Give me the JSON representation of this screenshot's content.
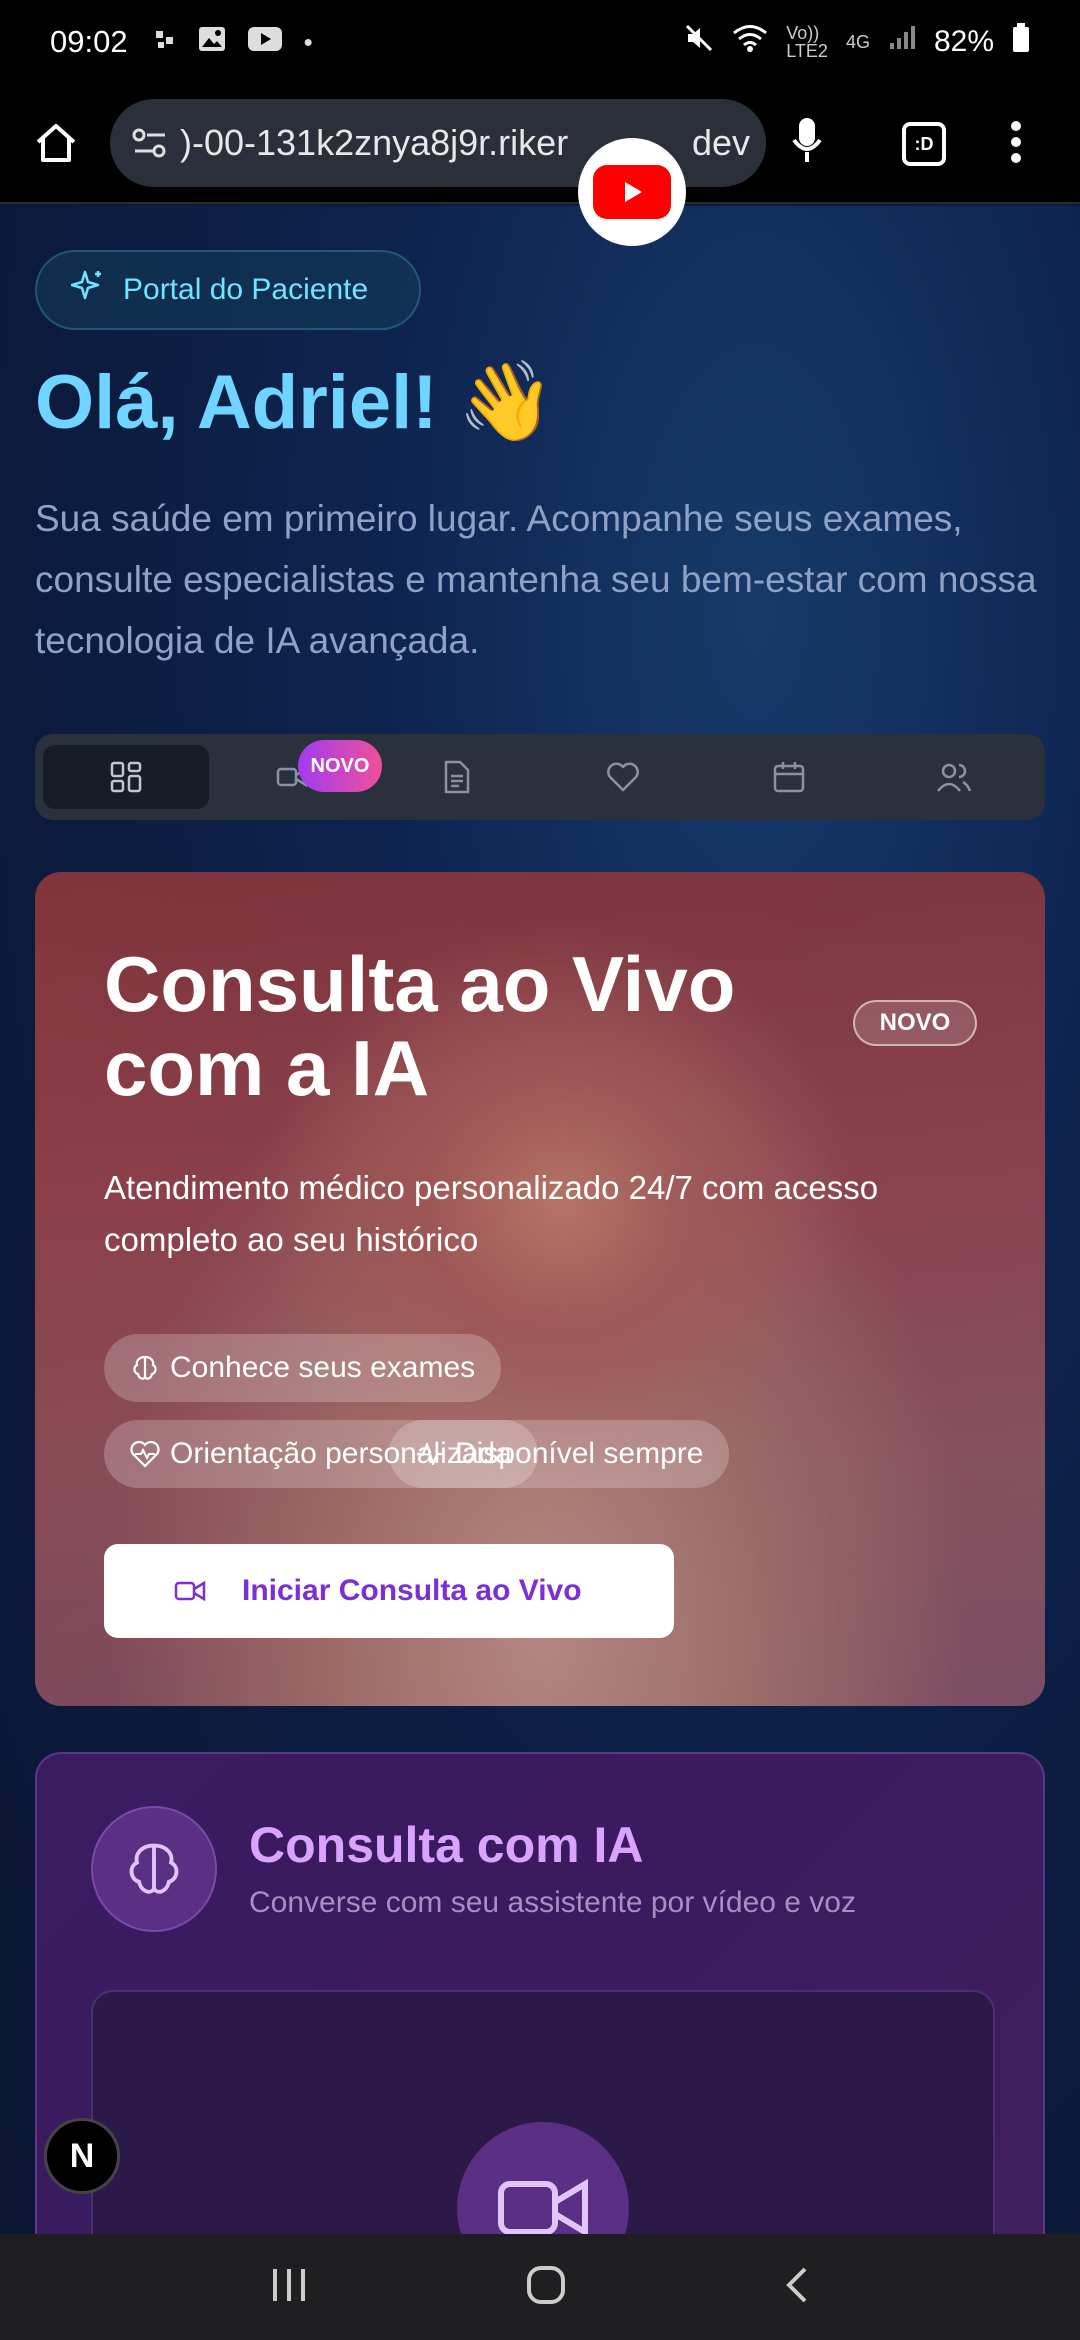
{
  "status_bar": {
    "time": "09:02",
    "net_label_top": "Vo))",
    "net_label_bottom": "LTE2",
    "net_4g": "4G",
    "battery": "82%"
  },
  "browser": {
    "url": ")-00-131k2znya8j9r.riker",
    "url_tail": "dev"
  },
  "hero": {
    "portal_label": "Portal do Paciente",
    "greeting": "Olá, Adriel!",
    "wave_emoji": "👋",
    "intro": "Sua saúde em primeiro lugar. Acompanhe seus exames, consulte especialistas e mantenha seu bem-estar com nossa tecnologia de IA avançada."
  },
  "tabs": {
    "badge": "NOVO",
    "items": [
      {
        "icon": "dashboard-icon"
      },
      {
        "icon": "video-icon"
      },
      {
        "icon": "document-icon"
      },
      {
        "icon": "heart-icon"
      },
      {
        "icon": "calendar-icon"
      },
      {
        "icon": "users-icon"
      }
    ]
  },
  "live_card": {
    "title": "Consulta ao Vivo com a IA",
    "tag": "NOVO",
    "subtitle": "Atendimento médico personalizado 24/7 com acesso completo ao seu histórico",
    "chips": [
      "Conhece seus exames",
      "Orientação personalizada",
      "Disponível sempre"
    ],
    "cta": "Iniciar Consulta ao Vivo"
  },
  "ai_card": {
    "title": "Consulta com IA",
    "subtitle": "Converse com seu assistente por vídeo e voz"
  },
  "floating": {
    "n_label": "N"
  },
  "colors": {
    "accent_cyan": "#6fd4ff",
    "accent_purple": "#7b2fd6",
    "badge_gradient_start": "#a23bf0",
    "badge_gradient_end": "#f0509a"
  }
}
